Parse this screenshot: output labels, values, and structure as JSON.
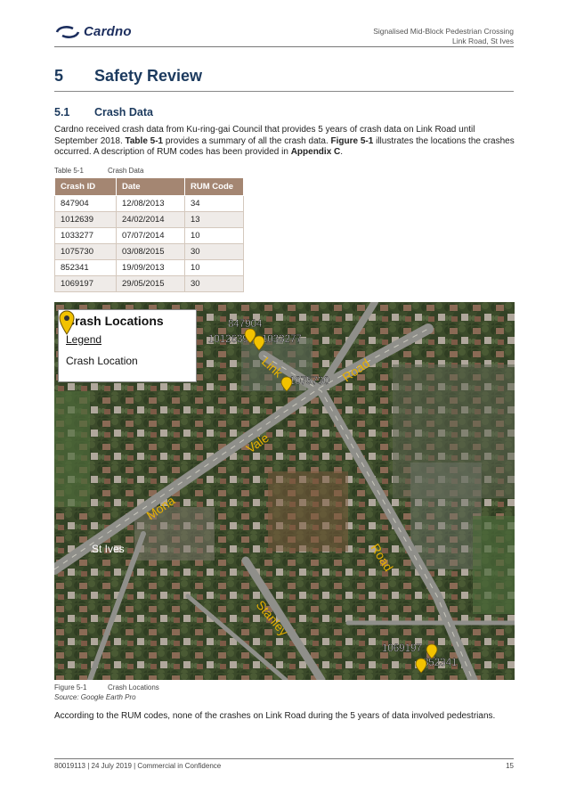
{
  "header": {
    "logo_text": "Cardno",
    "title_line1": "Signalised Mid-Block Pedestrian Crossing",
    "title_line2": "Link Road, St Ives"
  },
  "section": {
    "number": "5",
    "title": "Safety Review"
  },
  "subsection": {
    "number": "5.1",
    "title": "Crash Data"
  },
  "intro": {
    "p1": "Cardno received crash data from Ku-ring-gai Council that provides 5 years of crash data on Link Road until September 2018. ",
    "ref1": "Table 5-1",
    "p2": " provides a summary of all the crash data. ",
    "ref2": "Figure 5-1",
    "p3": " illustrates the locations the crashes occurred. A description of RUM codes has been provided in ",
    "ref3": "Appendix C",
    "p4": "."
  },
  "table_caption": {
    "label": "Table 5-1",
    "title": "Crash Data"
  },
  "table": {
    "headers": [
      "Crash ID",
      "Date",
      "RUM Code"
    ],
    "rows": [
      [
        "847904",
        "12/08/2013",
        "34"
      ],
      [
        "1012639",
        "24/02/2014",
        "13"
      ],
      [
        "1033277",
        "07/07/2014",
        "10"
      ],
      [
        "1075730",
        "03/08/2015",
        "30"
      ],
      [
        "852341",
        "19/09/2013",
        "10"
      ],
      [
        "1069197",
        "29/05/2015",
        "30"
      ]
    ]
  },
  "map": {
    "legend_title": "Crash Locations",
    "legend_subtitle": "Legend",
    "legend_item": "Crash Location",
    "pin_color": "#f2c200",
    "road_label_color": "#e8b100",
    "road_labels": [
      "Link",
      "Road",
      "Vale",
      "Mona",
      "Road",
      "Stanley"
    ],
    "place_label": "St Ives",
    "markers": [
      "847904",
      "1012639",
      "1033277",
      "1075730",
      "1069197",
      "852341"
    ]
  },
  "figure_caption": {
    "label": "Figure 5-1",
    "title": "Crash Locations",
    "source": "Source: Google Earth Pro"
  },
  "conclusion": "According to the RUM codes, none of the crashes on Link Road during the 5 years of data involved pedestrians.",
  "footer": {
    "left": "80019113 | 24 July 2019 | Commercial in Confidence",
    "page": "15"
  }
}
